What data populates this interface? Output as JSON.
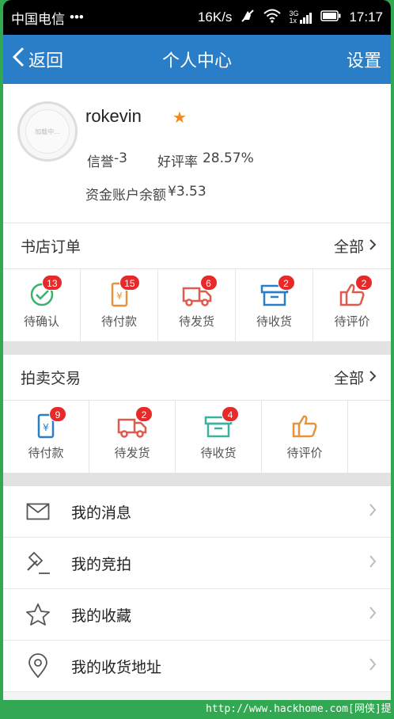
{
  "status_bar": {
    "carrier": "中国电信",
    "dots": "•••",
    "speed": "16K/s",
    "net": "3G",
    "net2": "1x",
    "time": "17:17"
  },
  "nav": {
    "back": "返回",
    "title": "个人中心",
    "settings": "设置"
  },
  "profile": {
    "avatar_text": "加载中...",
    "username": "rokevin",
    "credit_label": "信誉",
    "credit_value": "-3",
    "rating_label": "好评率",
    "rating_value": "28.57%",
    "balance_label": "资金账户余额",
    "balance_value": "¥3.53"
  },
  "bookstore": {
    "title": "书店订单",
    "all": "全部",
    "items": [
      {
        "label": "待确认",
        "badge": "13",
        "icon": "check-circle-icon",
        "color": "#3ab26e"
      },
      {
        "label": "待付款",
        "badge": "15",
        "icon": "wallet-icon",
        "color": "#e8923a"
      },
      {
        "label": "待发货",
        "badge": "6",
        "icon": "truck-icon",
        "color": "#e05a4e"
      },
      {
        "label": "待收货",
        "badge": "2",
        "icon": "box-icon",
        "color": "#2a7ec7"
      },
      {
        "label": "待评价",
        "badge": "2",
        "icon": "thumbs-up-icon",
        "color": "#e05a4e"
      }
    ]
  },
  "auction": {
    "title": "拍卖交易",
    "all": "全部",
    "items": [
      {
        "label": "待付款",
        "badge": "9",
        "icon": "wallet-icon",
        "color": "#2a7ec7"
      },
      {
        "label": "待发货",
        "badge": "2",
        "icon": "truck-icon",
        "color": "#e05a4e"
      },
      {
        "label": "待收货",
        "badge": "4",
        "icon": "box-icon",
        "color": "#3ab29e"
      },
      {
        "label": "待评价",
        "badge": "",
        "icon": "thumbs-up-icon",
        "color": "#e8923a"
      }
    ]
  },
  "menu": [
    {
      "label": "我的消息",
      "icon": "mail-icon"
    },
    {
      "label": "我的竞拍",
      "icon": "gavel-icon"
    },
    {
      "label": "我的收藏",
      "icon": "star-icon"
    },
    {
      "label": "我的收货地址",
      "icon": "location-pin-icon"
    }
  ],
  "watermark": "http://www.hackhome.com[网侠]提供",
  "colors": {
    "nav": "#2a7ec7",
    "badge": "#e62929",
    "frame": "#33a852"
  }
}
